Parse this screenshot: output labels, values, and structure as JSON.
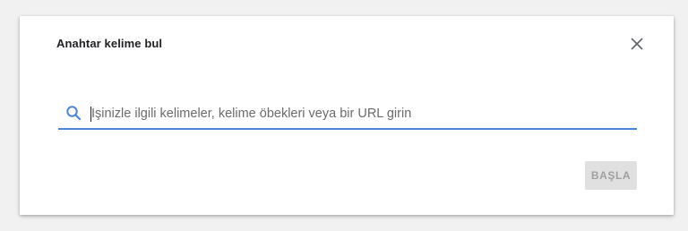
{
  "dialog": {
    "title": "Anahtar kelime bul",
    "close_icon": "close-icon",
    "search": {
      "icon": "search-icon",
      "placeholder": "İşinizle ilgili kelimeler, kelime öbekleri veya bir URL girin",
      "value": "",
      "underline_color": "#4a84d6",
      "icon_color": "#4a84d6"
    },
    "start_button": {
      "label": "BAŞLA",
      "disabled": true
    }
  }
}
